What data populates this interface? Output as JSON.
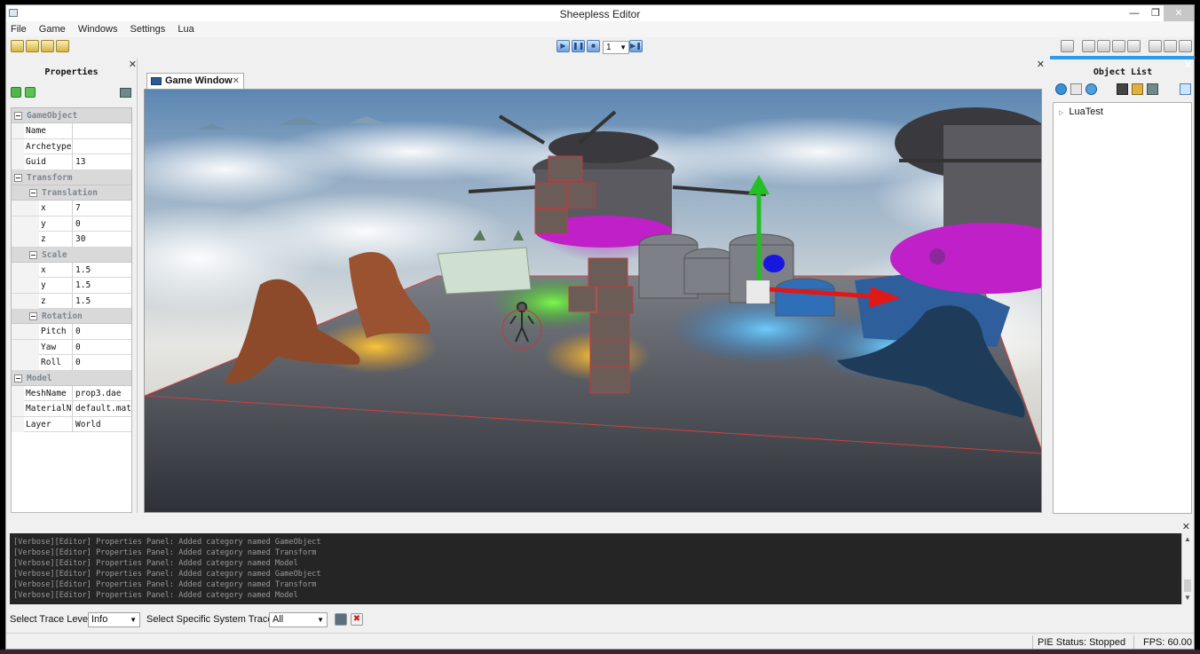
{
  "window": {
    "title": "Sheepless Editor",
    "close_glyph": "✕",
    "minimize_glyph": "—",
    "maximize_glyph": "❐"
  },
  "menu": [
    "File",
    "Game",
    "Windows",
    "Settings",
    "Lua"
  ],
  "toolbar": {
    "speed_value": "1",
    "playback_glyphs": {
      "play": "▶",
      "pause": "❚❚",
      "stop": "■",
      "step": "▶❚"
    }
  },
  "properties_panel": {
    "title": "Properties",
    "close_glyph": "✕",
    "rows": [
      {
        "type": "category",
        "indent": 0,
        "label": "GameObject"
      },
      {
        "type": "prop",
        "indent": 0,
        "key": "Name",
        "value": ""
      },
      {
        "type": "prop",
        "indent": 0,
        "key": "Archetype",
        "value": ""
      },
      {
        "type": "prop",
        "indent": 0,
        "key": "Guid",
        "value": "13"
      },
      {
        "type": "category",
        "indent": 0,
        "label": "Transform"
      },
      {
        "type": "category",
        "indent": 1,
        "label": "Translation"
      },
      {
        "type": "prop",
        "indent": 1,
        "key": "x",
        "value": "7"
      },
      {
        "type": "prop",
        "indent": 1,
        "key": "y",
        "value": "0"
      },
      {
        "type": "prop",
        "indent": 1,
        "key": "z",
        "value": "30"
      },
      {
        "type": "category",
        "indent": 1,
        "label": "Scale"
      },
      {
        "type": "prop",
        "indent": 1,
        "key": "x",
        "value": "1.5"
      },
      {
        "type": "prop",
        "indent": 1,
        "key": "y",
        "value": "1.5"
      },
      {
        "type": "prop",
        "indent": 1,
        "key": "z",
        "value": "1.5"
      },
      {
        "type": "category",
        "indent": 1,
        "label": "Rotation"
      },
      {
        "type": "prop",
        "indent": 1,
        "key": "Pitch",
        "value": "0"
      },
      {
        "type": "prop",
        "indent": 1,
        "key": "Yaw",
        "value": "0"
      },
      {
        "type": "prop",
        "indent": 1,
        "key": "Roll",
        "value": "0"
      },
      {
        "type": "category",
        "indent": 0,
        "label": "Model"
      },
      {
        "type": "prop",
        "indent": 0,
        "key": "MeshName",
        "value": "prop3.dae"
      },
      {
        "type": "prop",
        "indent": 0,
        "key": "MaterialN",
        "value": "default.mat"
      },
      {
        "type": "prop",
        "indent": 0,
        "key": "Layer",
        "value": "World"
      }
    ]
  },
  "game_window": {
    "tab_label": "Game Window",
    "tab_close": "✕",
    "close_glyph": "✕"
  },
  "object_list": {
    "title": "Object List",
    "close_glyph": "✕",
    "items": [
      "LuaTest"
    ]
  },
  "log": {
    "close_glyph": "✕",
    "lines": [
      "[Verbose][Editor] Properties Panel: Added category named GameObject",
      "[Verbose][Editor] Properties Panel: Added category named Transform",
      "[Verbose][Editor] Properties Panel: Added category named Model",
      "[Verbose][Editor] Properties Panel: Added category named GameObject",
      "[Verbose][Editor] Properties Panel: Added category named Transform",
      "[Verbose][Editor] Properties Panel: Added category named Model"
    ]
  },
  "trace": {
    "level_label": "Select Trace Level",
    "level_value": "Info",
    "system_label": "Select Specific System Trace",
    "system_value": "All",
    "clear_glyph": "✖"
  },
  "status": {
    "pie_status": "PIE Status: Stopped",
    "fps": "FPS: 60.00"
  },
  "colors": {
    "accent": "#2f9bf0",
    "log_bg": "#252525",
    "category_bg": "#d9d9d9"
  }
}
